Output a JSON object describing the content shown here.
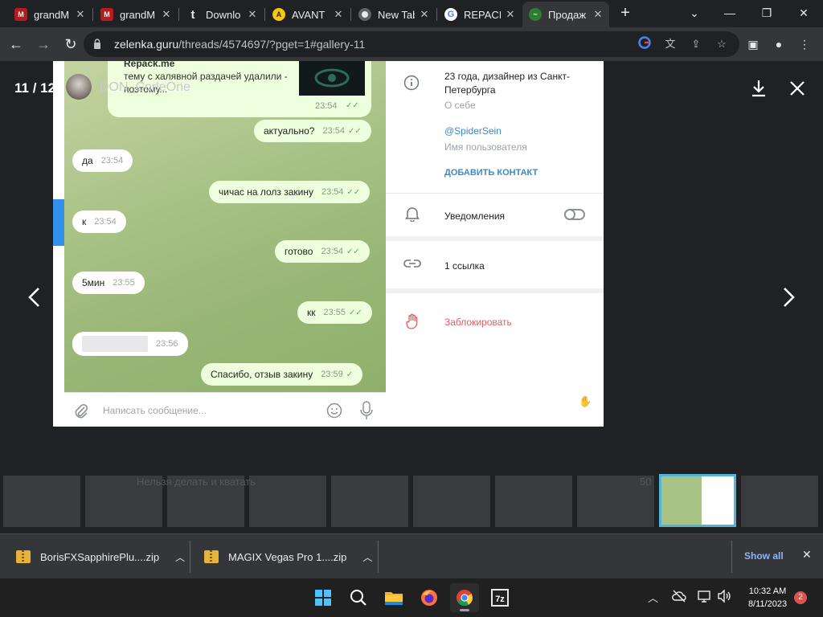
{
  "browser": {
    "tabs": [
      {
        "label": "grandM",
        "icon": "grandm-icon",
        "color": "#b71c1c"
      },
      {
        "label": "grandM",
        "icon": "grandm-icon",
        "color": "#b71c1c"
      },
      {
        "label": "Downlo",
        "icon": "t-logo-icon",
        "color": "#202124"
      },
      {
        "label": "AVANT",
        "icon": "avant-icon",
        "color": "#f6c90e"
      },
      {
        "label": "New Tab",
        "icon": "chrome-icon",
        "color": "#5f6368"
      },
      {
        "label": "REPACK",
        "icon": "google-icon",
        "color": "#ffffff"
      },
      {
        "label": "Продаж",
        "icon": "lolz-icon",
        "color": "#2e7d32",
        "active": true
      }
    ],
    "url": {
      "host": "zelenka.guru",
      "path": "/threads/4574697/?pget=1#gallery-11"
    }
  },
  "viewer": {
    "counter": "11 / 12",
    "author": "DON_CorleOne",
    "thumbs_ghost_text": "Нельзя делать и кватать",
    "thumbs_ghost_text2": "50"
  },
  "chat": {
    "quote": {
      "sender": "Repack.me",
      "line1": "тему с халявной раздачей удалили -",
      "line2": "поэтому...",
      "time": "23:54"
    },
    "messages": [
      {
        "dir": "out",
        "text": "актуально?",
        "time": "23:54"
      },
      {
        "dir": "in",
        "text": "да",
        "time": "23:54"
      },
      {
        "dir": "out",
        "text": "чичас на лолз закину",
        "time": "23:54"
      },
      {
        "dir": "in",
        "text": "к",
        "time": "23:54"
      },
      {
        "dir": "out",
        "text": "готово",
        "time": "23:54"
      },
      {
        "dir": "in",
        "text": "5мин",
        "time": "23:55"
      },
      {
        "dir": "out",
        "text": "кк",
        "time": "23:55"
      },
      {
        "dir": "in",
        "text": "",
        "time": "23:56"
      },
      {
        "dir": "out",
        "text": "Спасибо, отзыв закину",
        "time": "23:59"
      }
    ],
    "composer_placeholder": "Написать сообщение..."
  },
  "profile": {
    "bio_line1": "23 года, дизайнер из Санкт-",
    "bio_line2": "Петербурга",
    "bio_caption": "О себе",
    "username": "@SpiderSein",
    "username_caption": "Имя пользователя",
    "add_contact": "ДОБАВИТЬ КОНТАКТ",
    "notifications": "Уведомления",
    "links": "1 ссылка",
    "block": "Заблокировать",
    "colors": {
      "link": "#3a8bc9",
      "danger": "#e25c5c"
    }
  },
  "downloads": {
    "items": [
      {
        "name": "BorisFXSapphirePlu....zip"
      },
      {
        "name": "MAGIX Vegas Pro 1....zip"
      }
    ],
    "show_all": "Show all"
  },
  "taskbar": {
    "time": "10:32 AM",
    "date": "8/11/2023",
    "notifications": "2"
  }
}
